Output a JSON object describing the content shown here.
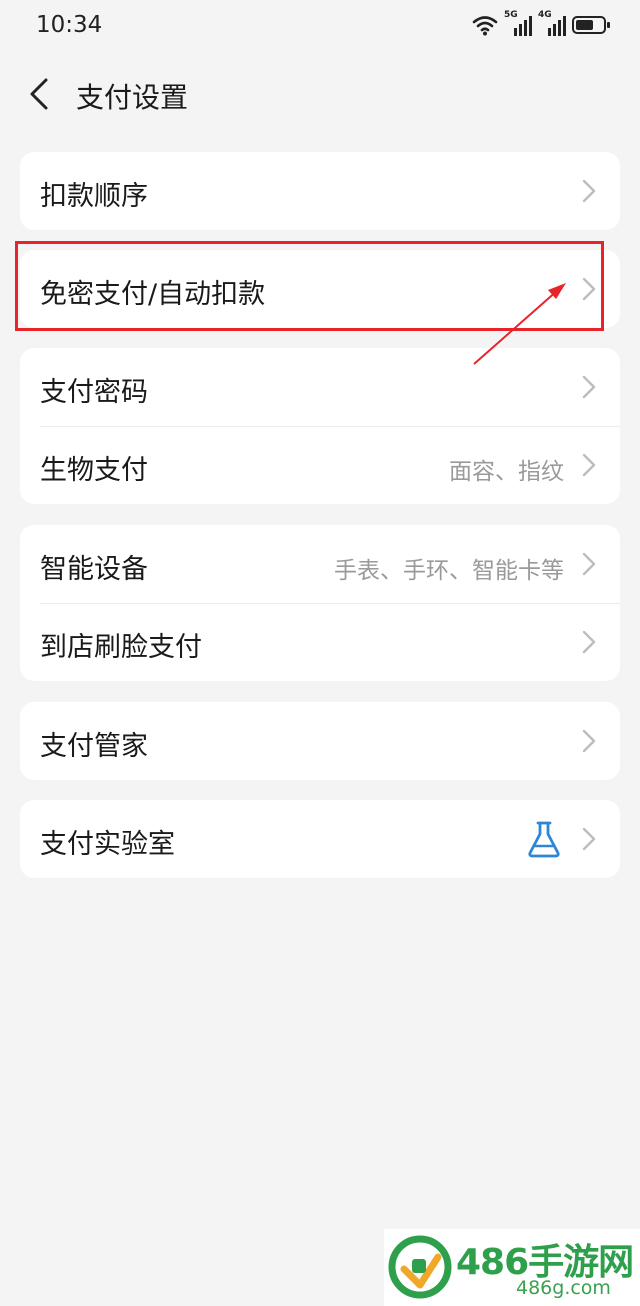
{
  "status_bar": {
    "time": "10:34",
    "icons": [
      "wifi-icon",
      "signal-5g-icon",
      "signal-4g-icon",
      "battery-icon"
    ],
    "net1_label": "5G",
    "net2_label": "4G"
  },
  "header": {
    "title": "支付设置",
    "back_icon": "chevron-left-icon"
  },
  "groups": [
    {
      "items": [
        {
          "label": "扣款顺序",
          "value": ""
        }
      ]
    },
    {
      "items": [
        {
          "label": "免密支付/自动扣款",
          "value": "",
          "highlighted": true
        }
      ]
    },
    {
      "items": [
        {
          "label": "支付密码",
          "value": ""
        },
        {
          "label": "生物支付",
          "value": "面容、指纹"
        }
      ]
    },
    {
      "items": [
        {
          "label": "智能设备",
          "value": "手表、手环、智能卡等"
        },
        {
          "label": "到店刷脸支付",
          "value": ""
        }
      ]
    },
    {
      "items": [
        {
          "label": "支付管家",
          "value": ""
        }
      ]
    },
    {
      "items": [
        {
          "label": "支付实验室",
          "value": "",
          "icon": "flask-icon"
        }
      ]
    }
  ],
  "colors": {
    "background": "#f4f4f4",
    "card": "#ffffff",
    "highlight": "#e8242a",
    "flask_icon": "#2f86d6",
    "watermark": "#2e9f4a"
  },
  "watermark": {
    "brand": "486手游网",
    "url": "486g.com"
  }
}
